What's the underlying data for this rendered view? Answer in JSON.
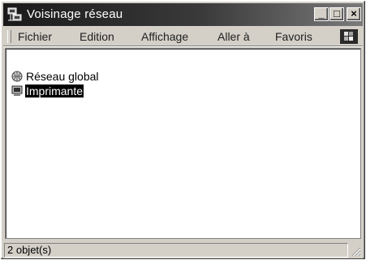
{
  "window": {
    "title": "Voisinage réseau",
    "minimize_label": "_",
    "maximize_label": "□",
    "close_label": "×"
  },
  "menubar": {
    "items": [
      {
        "label": "Fichier"
      },
      {
        "label": "Edition"
      },
      {
        "label": "Affichage"
      },
      {
        "label": "Aller à"
      },
      {
        "label": "Favoris"
      }
    ]
  },
  "list": {
    "items": [
      {
        "label": "Réseau global",
        "icon": "network-globe-icon",
        "selected": false
      },
      {
        "label": "Imprimante",
        "icon": "computer-icon",
        "selected": true
      }
    ]
  },
  "status": {
    "text": "2 objet(s)"
  },
  "colors": {
    "titlebar_start": "#1a1a1a",
    "titlebar_end": "#7a7a7a",
    "chrome": "#d4d0c8",
    "selection": "#000000"
  }
}
